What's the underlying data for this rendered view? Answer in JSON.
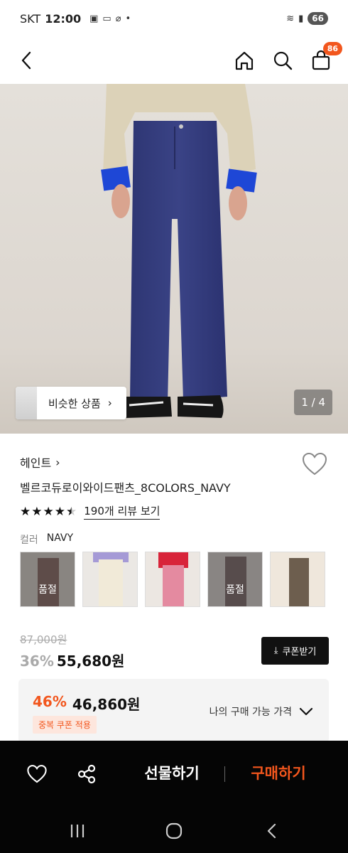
{
  "status_bar": {
    "carrier": "SKT",
    "time": "12:00",
    "battery": "66"
  },
  "header": {
    "cart_count": "86",
    "icons": [
      "back-icon",
      "home-icon",
      "search-icon",
      "cart-icon"
    ]
  },
  "hero": {
    "similar_label": "비슷한 상품",
    "pager": "1 / 4"
  },
  "product": {
    "brand": "헤인트",
    "name": "벨르코듀로이와이드팬츠_8COLORS_NAVY",
    "rating": 4.5,
    "review_link": "190개 리뷰 보기",
    "color_label": "컬러",
    "color_value": "NAVY",
    "swatches": [
      {
        "color": "#7a5a55",
        "soldout": "품절"
      },
      {
        "color": "#ece6d6",
        "soldout": ""
      },
      {
        "color": "#e48aa0",
        "soldout": ""
      },
      {
        "color": "#6e5a5a",
        "soldout": "품절"
      },
      {
        "color": "#6d5e4e",
        "soldout": ""
      }
    ]
  },
  "price": {
    "original": "87,000원",
    "discount": "36%",
    "sale": "55,680원",
    "coupon_button": "쿠폰받기"
  },
  "benefit": {
    "rate": "46%",
    "amount": "46,860원",
    "dup_coupon": "중복 쿠폰 적용",
    "my_price": "나의 구매 가능 가격"
  },
  "action_bar": {
    "gift": "선물하기",
    "buy": "구매하기"
  },
  "colors": {
    "accent": "#f2561d",
    "dark": "#050505"
  }
}
